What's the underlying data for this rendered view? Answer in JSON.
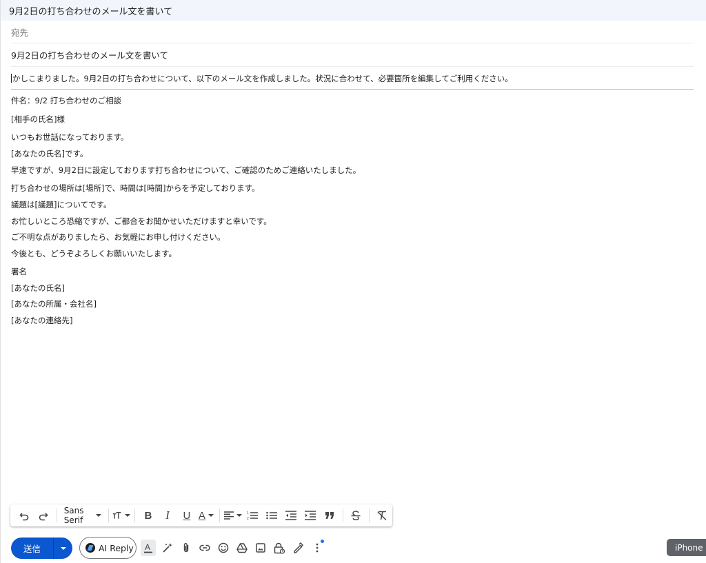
{
  "window": {
    "title": "9月2日の打ち合わせのメール文を書いて"
  },
  "to": {
    "placeholder": "宛先"
  },
  "subject": {
    "value": "9月2日の打ち合わせのメール文を書いて"
  },
  "body": {
    "intro": "かしこまりました。9月2日の打ち合わせについて、以下のメール文を作成しました。状況に合わせて、必要箇所を編集してご利用ください。",
    "lines": [
      "件名：9/2 打ち合わせのご相談",
      "[相手の氏名]様",
      "いつもお世話になっております。",
      "[あなたの氏名]です。",
      "早速ですが、9月2日に設定しております打ち合わせについて、ご確認のためご連絡いたしました。",
      "打ち合わせの場所は[場所]で、時間は[時間]からを予定しております。",
      "議題は[議題]についてです。",
      "お忙しいところ恐縮ですが、ご都合をお聞かせいただけますと幸いです。",
      "ご不明な点がありましたら、お気軽にお申し付けください。",
      "今後とも、どうぞよろしくお願いいたします。",
      "署名",
      "[あなたの氏名]",
      "[あなたの所属・会社名]",
      "[あなたの連絡先]"
    ]
  },
  "format_toolbar": {
    "font": "Sans Serif",
    "icons": [
      "undo-icon",
      "redo-icon",
      "text-size-icon",
      "bold-icon",
      "italic-icon",
      "underline-icon",
      "text-color-icon",
      "align-icon",
      "numbered-list-icon",
      "bulleted-list-icon",
      "indent-less-icon",
      "indent-more-icon",
      "quote-icon",
      "strikethrough-icon",
      "remove-formatting-icon"
    ]
  },
  "bottom_bar": {
    "send_label": "送信",
    "ai_reply_label": "AI Reply",
    "icons": [
      "formatting-options-icon",
      "magic-wand-icon",
      "attach-icon",
      "link-icon",
      "emoji-icon",
      "drive-icon",
      "photo-icon",
      "confidential-mode-icon",
      "signature-icon",
      "more-options-icon"
    ]
  },
  "overlay": {
    "label": "iPhone ミ"
  },
  "colors": {
    "send": "#0b57d0",
    "titlebar_bg": "#f2f6fc",
    "badge": "#1a73e8"
  }
}
